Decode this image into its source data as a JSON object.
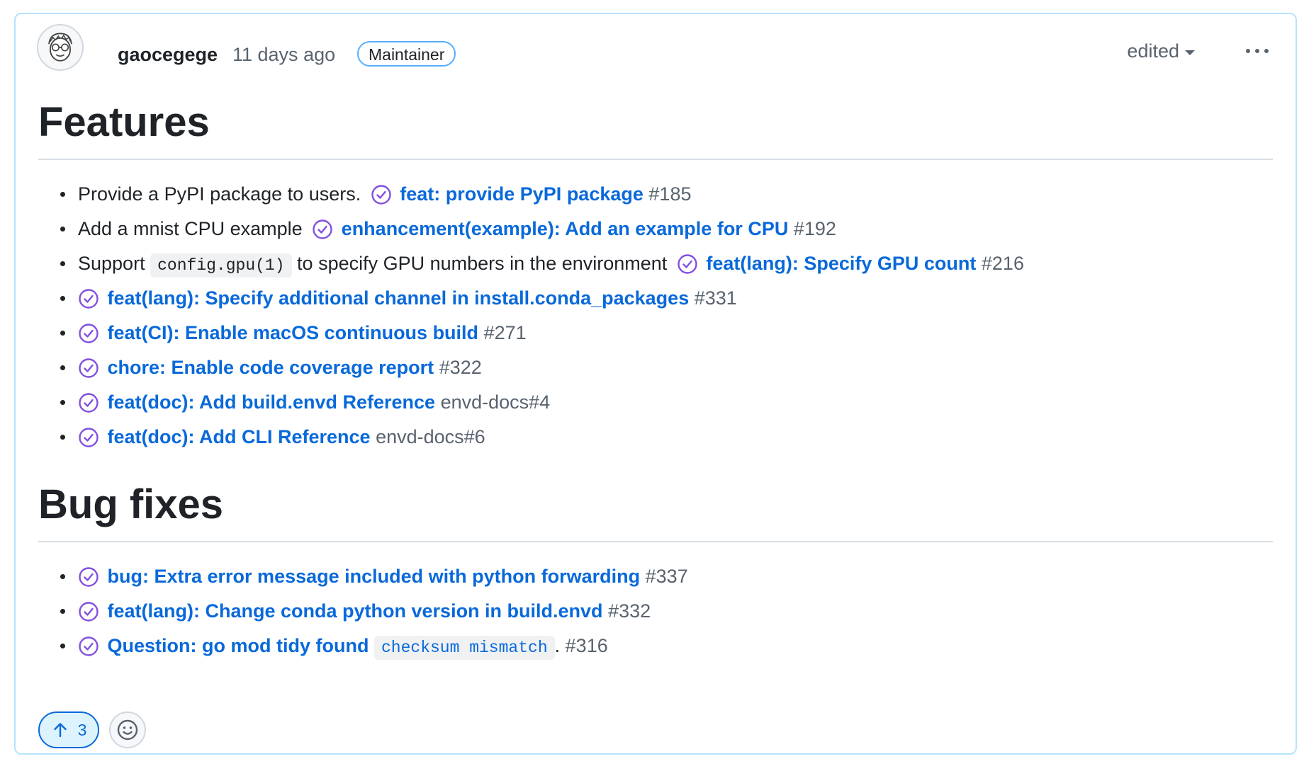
{
  "comment": {
    "author": "gaocegege",
    "time": "11 days ago",
    "role_badge": "Maintainer",
    "edited_label": "edited",
    "accent_color": "#0969da",
    "merged_icon_color": "#8250df"
  },
  "features": {
    "heading": "Features",
    "items": [
      {
        "text": "Provide a PyPI package to users.",
        "link": "feat: provide PyPI package",
        "ref": "#185"
      },
      {
        "text": "Add a mnist CPU example",
        "link": "enhancement(example): Add an example for CPU",
        "ref": "#192"
      },
      {
        "text_before": "Support",
        "code": "config.gpu(1)",
        "text_after": "to specify GPU numbers in the environment",
        "link": "feat(lang): Specify GPU count",
        "ref": "#216"
      },
      {
        "link": "feat(lang): Specify additional channel in install.conda_packages",
        "ref": "#331"
      },
      {
        "link": "feat(CI): Enable macOS continuous build",
        "ref": "#271"
      },
      {
        "link": "chore: Enable code coverage report",
        "ref": "#322"
      },
      {
        "link": "feat(doc): Add build.envd Reference",
        "ref": "envd-docs#4"
      },
      {
        "link": "feat(doc): Add CLI Reference",
        "ref": "envd-docs#6"
      }
    ]
  },
  "bugfixes": {
    "heading": "Bug fixes",
    "items": [
      {
        "link": "bug: Extra error message included with python forwarding",
        "ref": "#337"
      },
      {
        "link": "feat(lang): Change conda python version in build.envd",
        "ref": "#332"
      },
      {
        "link": "Question: go mod tidy found",
        "code": "checksum mismatch",
        "suffix": ".",
        "ref": "#316"
      }
    ]
  },
  "reactions": {
    "upvote_icon": "arrow-up-icon",
    "upvote_count": "3",
    "emoji_icon": "smiley-icon"
  }
}
